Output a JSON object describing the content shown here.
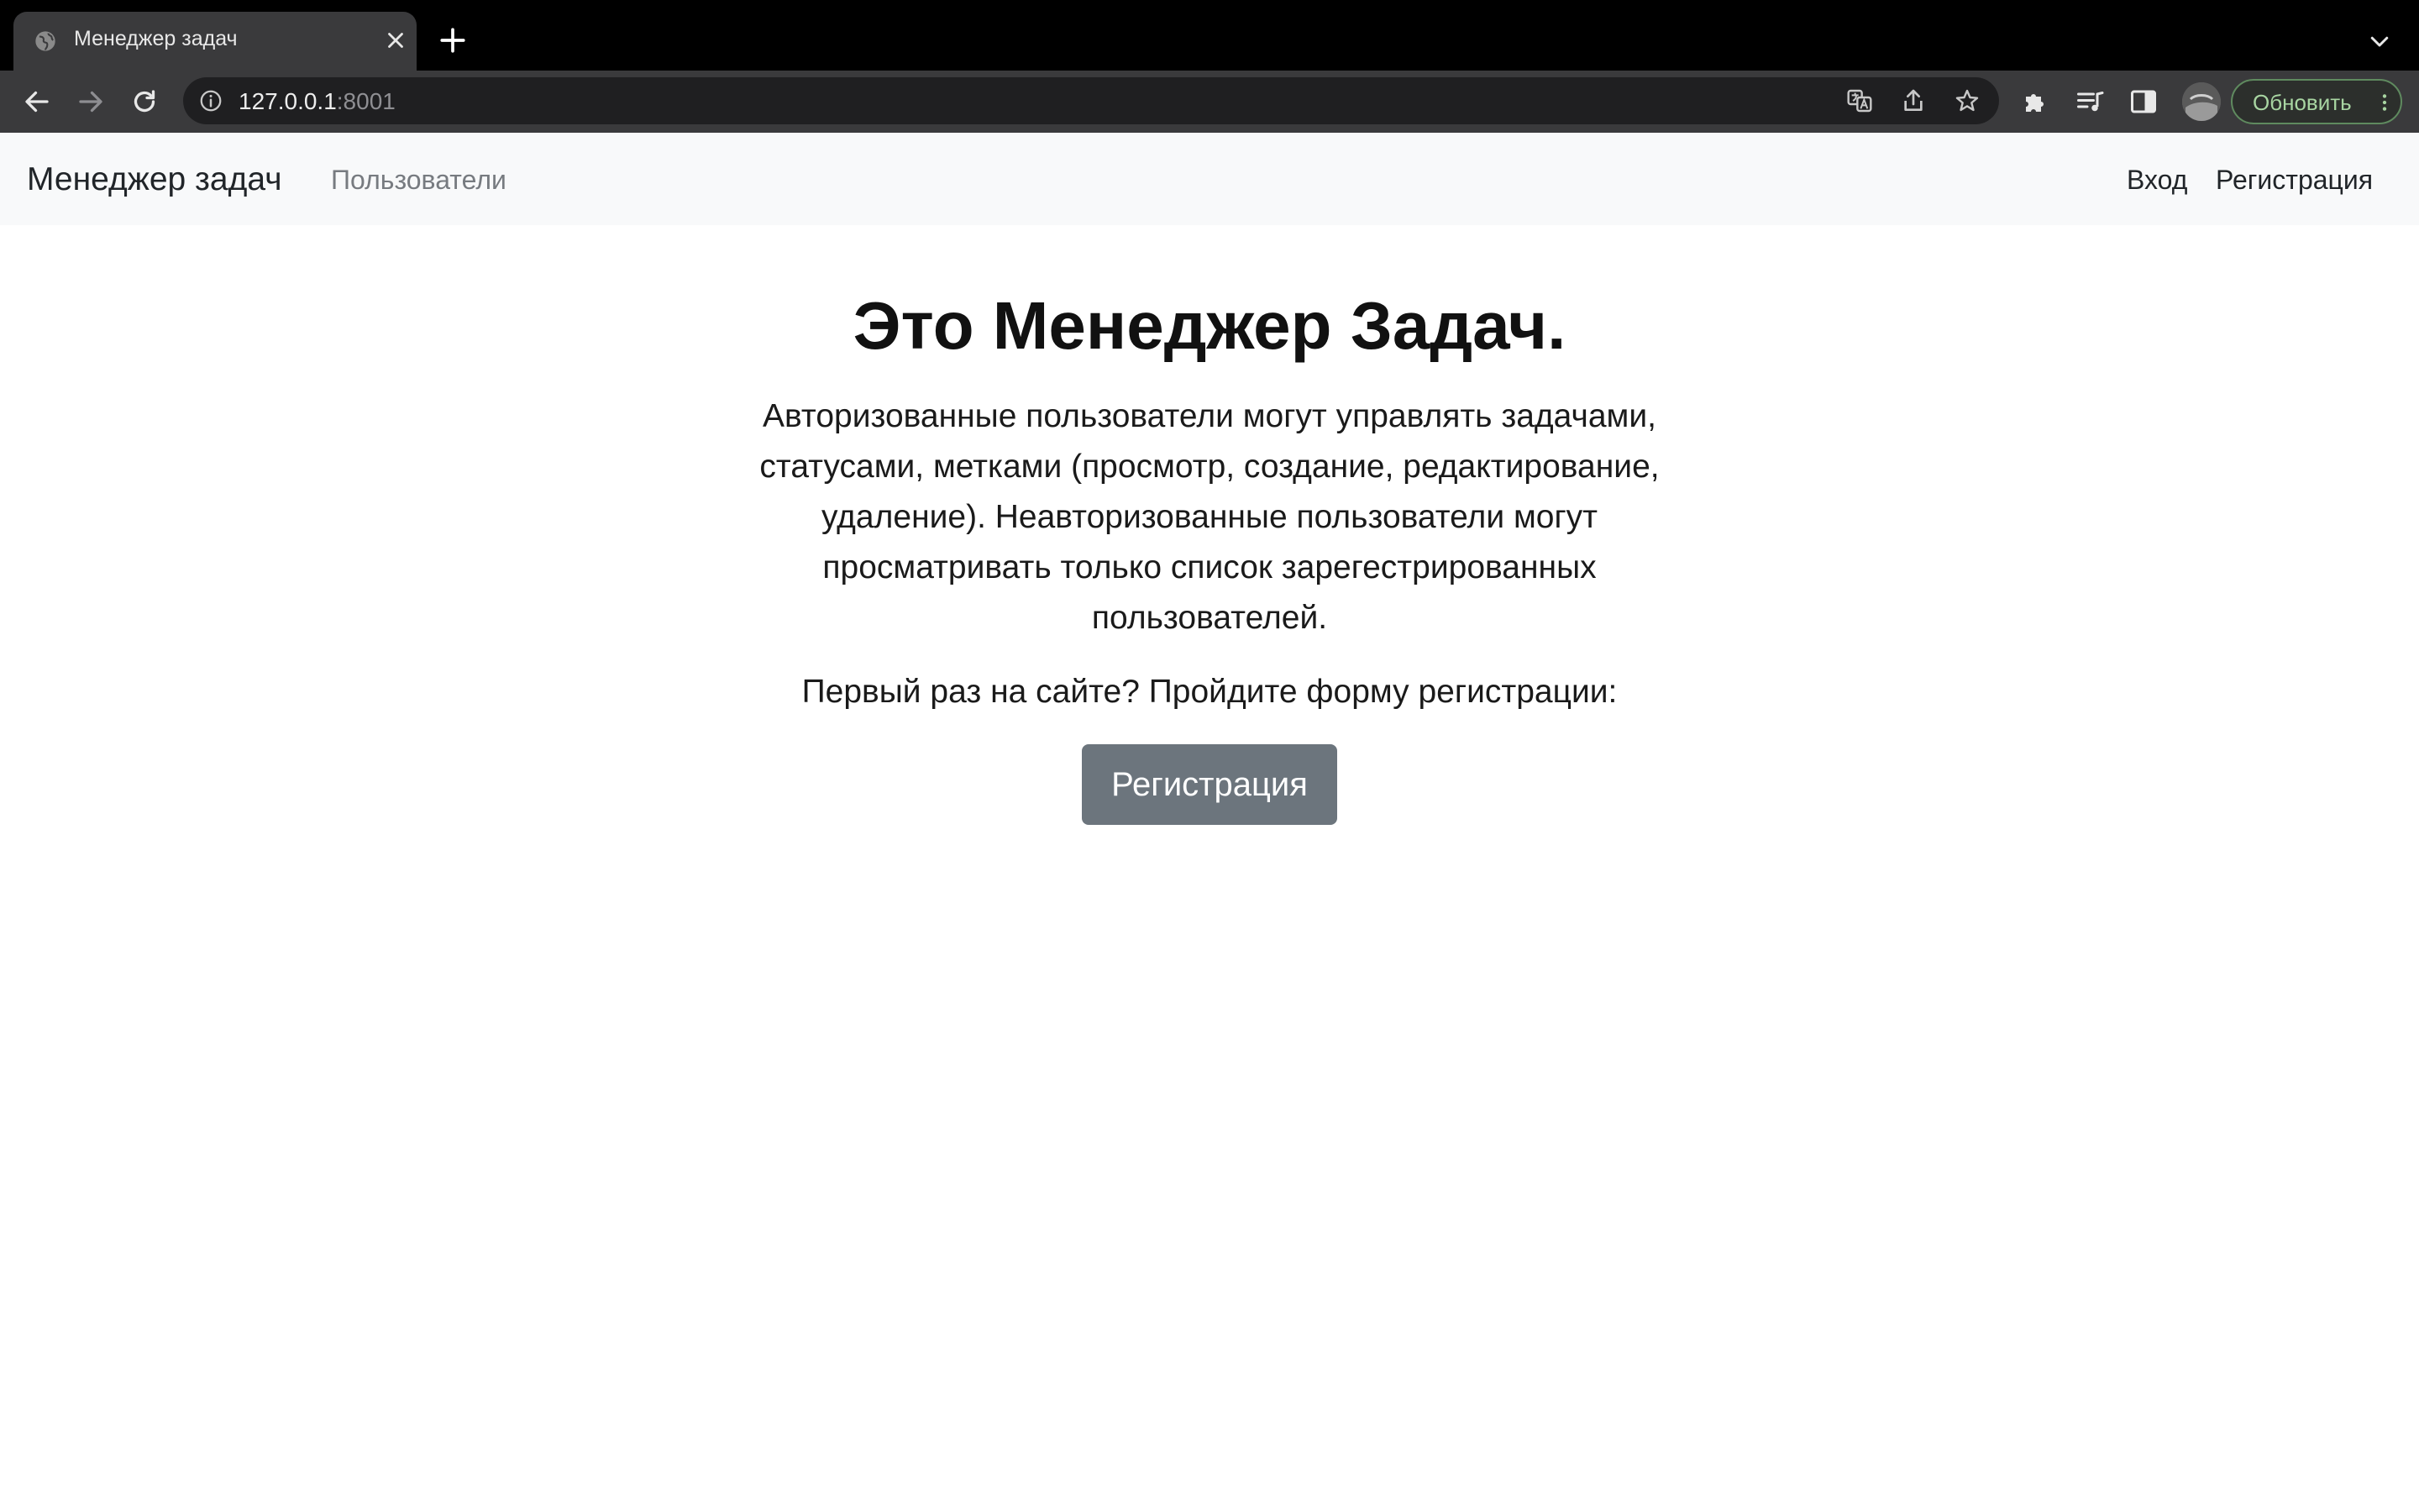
{
  "browser": {
    "tab_title": "Менеджер задач",
    "url_host": "127.0.0.1",
    "url_port": ":8001",
    "update_button_label": "Обновить",
    "icons": [
      "globe-icon",
      "close-icon",
      "plus-icon",
      "chevron-down-icon",
      "back-arrow-icon",
      "forward-arrow-icon",
      "reload-icon",
      "info-icon",
      "translate-icon",
      "share-icon",
      "star-icon",
      "puzzle-icon",
      "media-queue-icon",
      "side-panel-icon",
      "avatar",
      "more-vertical-icon"
    ]
  },
  "navbar": {
    "brand": "Менеджер задач",
    "users_link": "Пользователи",
    "login_link": "Вход",
    "register_link": "Регистрация"
  },
  "hero": {
    "title": "Это Менеджер Задач.",
    "description": "Авторизованные пользователи могут управлять задачами, статусами, метками (просмотр, создание, редактирование, удаление). Неавторизованные пользователи могут просматривать только список зарегестрированных пользователей.",
    "cta_text": "Первый раз на сайте? Пройдите форму регистрации:",
    "cta_button": "Регистрация"
  },
  "colors": {
    "navbar_bg": "#f8f9fa",
    "button_secondary": "#6c757d",
    "muted_link": "#777b80"
  }
}
